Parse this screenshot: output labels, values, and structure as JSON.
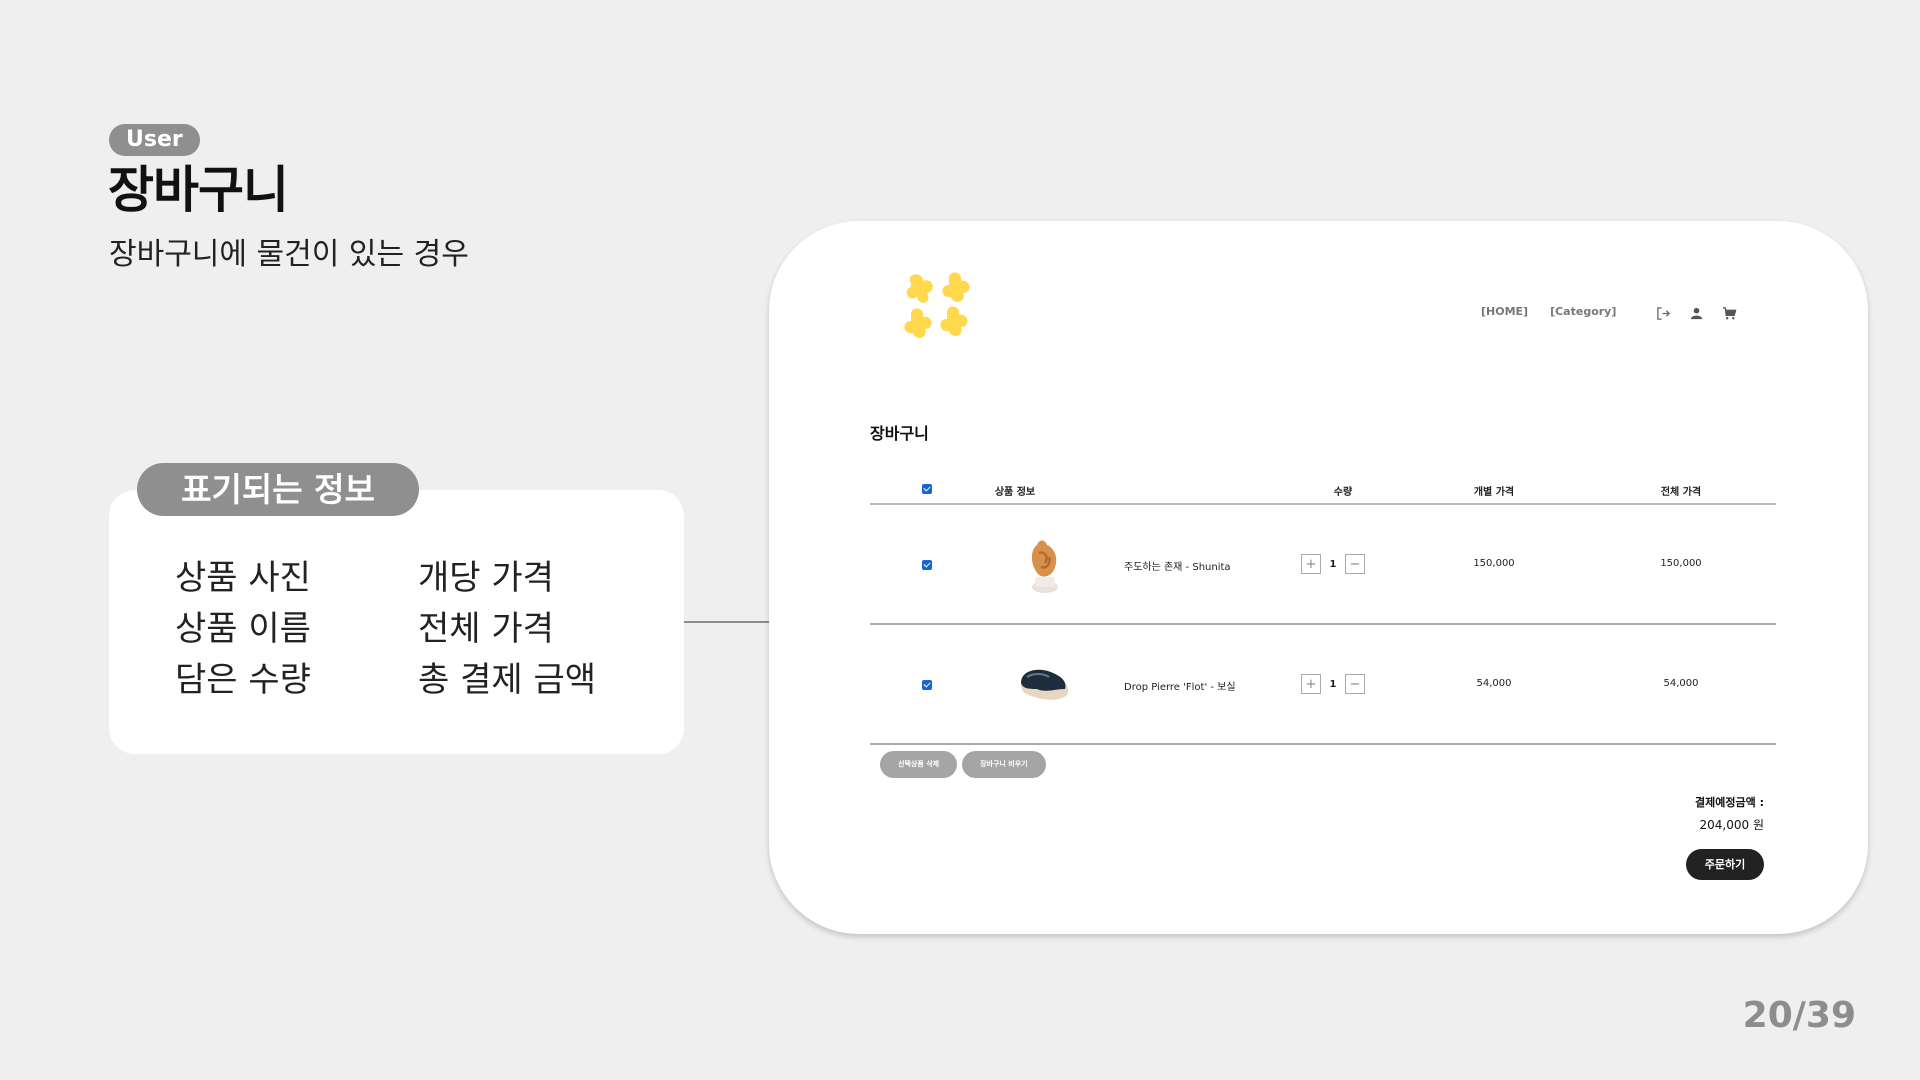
{
  "header": {
    "role": "User",
    "title": "장바구니",
    "subtitle": "장바구니에 물건이 있는 경우"
  },
  "info": {
    "tag": "표기되는 정보",
    "items": [
      "상품 사진",
      "개당 가격",
      "상품 이름",
      "전체 가격",
      "담은 수량",
      "총 결제 금액"
    ]
  },
  "mockup": {
    "logo_color": "#ffd84d",
    "nav": [
      "[HOME]",
      "[Category]"
    ],
    "icons": [
      "logout-icon",
      "user-icon",
      "cart-icon"
    ],
    "cart_heading": "장바구니",
    "columns": {
      "product_info": "상품 정보",
      "quantity": "수량",
      "unit_price": "개별 가격",
      "total_price": "전체 가격"
    },
    "rows": [
      {
        "name": "주도하는 존재 - Shunita",
        "qty": "1",
        "unit_price": "150,000",
        "total_price": "150,000",
        "checked": true
      },
      {
        "name": "Drop Pierre 'Flot' - 보실",
        "qty": "1",
        "unit_price": "54,000",
        "total_price": "54,000",
        "checked": true
      }
    ],
    "qty_plus": "+",
    "qty_minus": "−",
    "buttons": {
      "delete_selected": "선택상품 삭제",
      "empty_cart": "장바구니 비우기",
      "order": "주문하기"
    },
    "total_label": "결제예정금액 :",
    "total_value": "204,000 원"
  },
  "page_number": "20/39"
}
